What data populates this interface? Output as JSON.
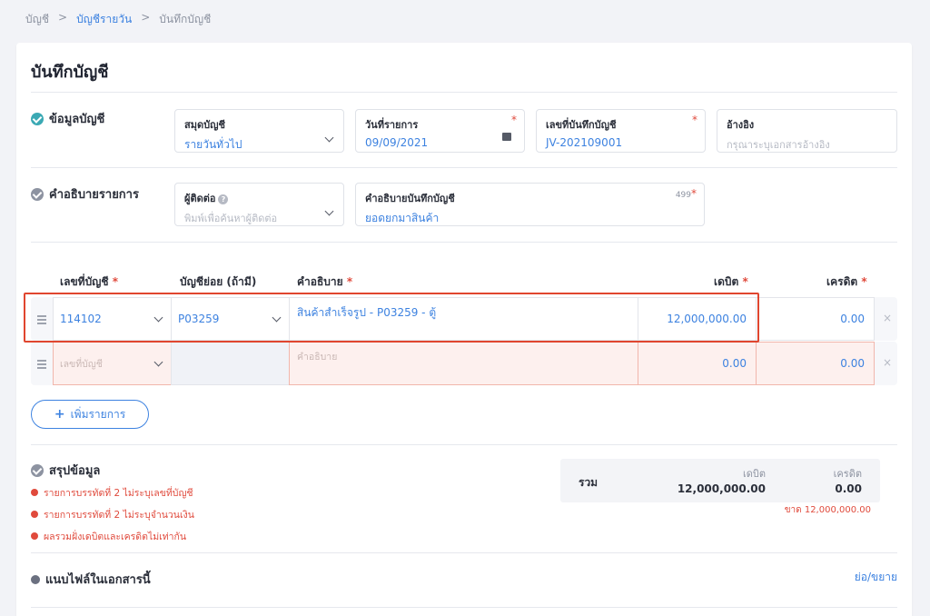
{
  "breadcrumb": {
    "items": [
      "บัญชี",
      "บัญชีรายวัน",
      "บันทึกบัญชี"
    ],
    "sep": ">"
  },
  "page": {
    "title": "บันทึกบัญชี"
  },
  "account_info": {
    "label": "ข้อมูลบัญชี",
    "book": {
      "label": "สมุดบัญชี",
      "value": "รายวันทั่วไป"
    },
    "date": {
      "label": "วันที่รายการ",
      "value": "09/09/2021",
      "required": "*"
    },
    "doc_no": {
      "label": "เลขที่บันทึกบัญชี",
      "value": "JV-202109001",
      "required": "*"
    },
    "reference": {
      "label": "อ้างอิง",
      "placeholder": "กรุณาระบุเอกสารอ้างอิง"
    }
  },
  "description_section": {
    "label": "คำอธิบายรายการ",
    "contact": {
      "label": "ผู้ติดต่อ",
      "help": "?",
      "placeholder": "พิมพ์เพื่อค้นหาผู้ติดต่อ"
    },
    "memo": {
      "label": "คำอธิบายบันทึกบัญชี",
      "value": "ยอดยกมาสินค้า",
      "counter": "499",
      "required": "*"
    }
  },
  "table": {
    "headers": {
      "account": "เลขที่บัญชี",
      "sub_account": "บัญชีย่อย (ถ้ามี)",
      "description": "คำอธิบาย",
      "debit": "เดบิต",
      "credit": "เครดิต",
      "star": "*"
    },
    "rows": [
      {
        "account": "114102",
        "sub_account": "P03259",
        "description": "สินค้าสำเร็จรูป - P03259 - ตู้",
        "debit": "12,000,000.00",
        "credit": "0.00",
        "remove": "×"
      },
      {
        "account_placeholder": "เลขที่บัญชี",
        "sub_account": "",
        "description_placeholder": "คำอธิบาย",
        "debit": "0.00",
        "credit": "0.00",
        "remove": "×"
      }
    ],
    "add_label": "เพิ่มรายการ",
    "add_icon": "+"
  },
  "summary": {
    "label": "สรุปข้อมูล",
    "errors": [
      "รายการบรรทัดที่ 2 ไม่ระบุเลขที่บัญชี",
      "รายการบรรทัดที่ 2 ไม่ระบุจำนวนเงิน",
      "ผลรวมฝั่งเดบิตและเครดิตไม่เท่ากัน"
    ],
    "total_label": "รวม",
    "debit_header": "เดบิต",
    "credit_header": "เครดิต",
    "debit_total": "12,000,000.00",
    "credit_total": "0.00",
    "difference": "ขาด 12,000,000.00"
  },
  "attachments": {
    "label": "แนบไฟล์ในเอกสารนี้",
    "toggle": "ย่อ/ขยาย"
  },
  "colors": {
    "accent": "#3d82e0",
    "error": "#e04a3c",
    "highlight": "#e0462f",
    "check": "#3ba9b4"
  }
}
